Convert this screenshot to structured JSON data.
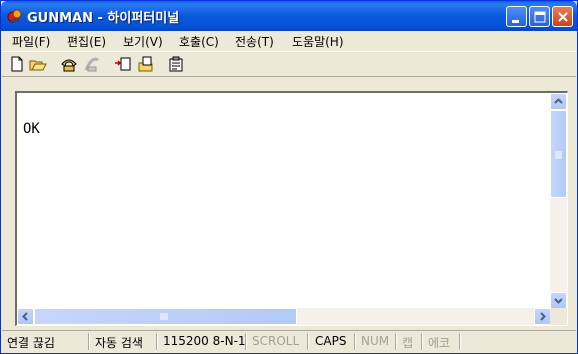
{
  "window": {
    "title": "GUNMAN - 하이퍼터미널",
    "controls": [
      "minimize",
      "maximize",
      "close"
    ]
  },
  "menu": {
    "items": [
      {
        "label": "파일(F)"
      },
      {
        "label": "편집(E)"
      },
      {
        "label": "보기(V)"
      },
      {
        "label": "호출(C)"
      },
      {
        "label": "전송(T)"
      },
      {
        "label": "도움말(H)"
      }
    ]
  },
  "toolbar": {
    "icons": [
      "new-icon",
      "open-icon",
      "call-icon",
      "disconnect-icon",
      "send-icon",
      "receive-icon",
      "properties-icon"
    ]
  },
  "terminal": {
    "output": "OK"
  },
  "status": {
    "connection": "연결 끊김",
    "detect": "자동 검색",
    "port_settings": "115200 8-N-1",
    "scroll": "SCROLL",
    "caps": "CAPS",
    "num": "NUM",
    "capture": "캡",
    "echo": "에코"
  }
}
